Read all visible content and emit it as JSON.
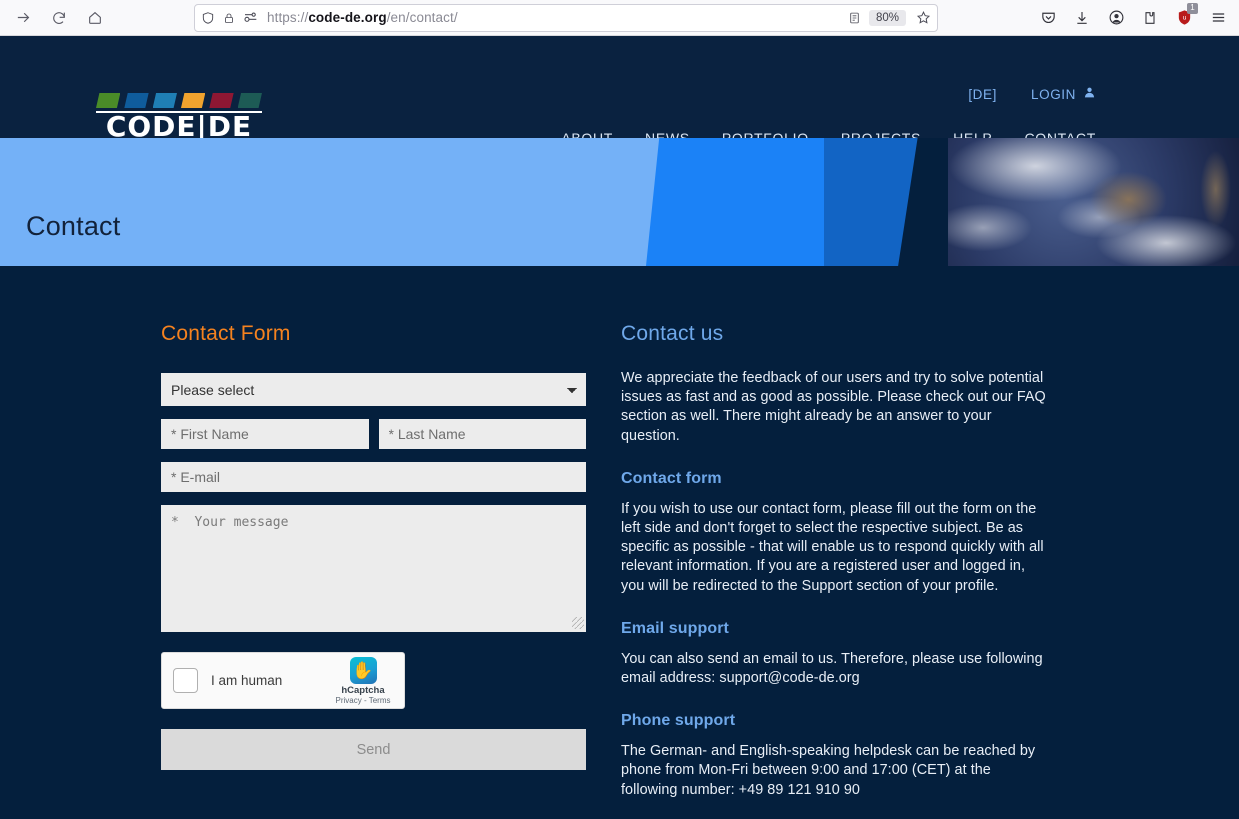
{
  "browser": {
    "url_prefix": "https://",
    "url_host": "code-de.org",
    "url_path": "/en/contact/",
    "zoom_level": "80%",
    "shield_badge": "1",
    "icons": {
      "forward": "forward-arrow-icon",
      "reload": "reload-icon",
      "home": "home-icon",
      "shield": "shield-icon",
      "lock": "lock-icon",
      "permissions": "permissions-icon",
      "reader": "reader-view-icon",
      "bookmark": "star-bookmark-icon",
      "pocket": "pocket-icon",
      "downloads": "downloads-icon",
      "account": "account-icon",
      "extension": "extension-icon",
      "ublock": "ublock-shield-icon",
      "menu": "hamburger-menu-icon"
    }
  },
  "site": {
    "logo_text": "CODE|DE",
    "logo_colors": [
      "#4a8c28",
      "#0f5c9c",
      "#1f7fb5",
      "#f0a32e",
      "#8e1733",
      "#1d5b55"
    ],
    "language_switch": "[DE]",
    "login_label": "LOGIN",
    "nav": [
      "ABOUT",
      "NEWS",
      "PORTFOLIO",
      "PROJECTS",
      "HELP",
      "CONTACT"
    ]
  },
  "hero": {
    "title": "Contact"
  },
  "form": {
    "heading": "Contact Form",
    "subject_selected": "Please select",
    "first_name_placeholder": "* First Name",
    "last_name_placeholder": "* Last Name",
    "email_placeholder": "* E-mail",
    "message_placeholder": "*  Your message",
    "captcha": {
      "checkbox_label": "I am human",
      "brand": "hCaptcha",
      "terms": "Privacy - Terms"
    },
    "send_label": "Send"
  },
  "info": {
    "heading": "Contact us",
    "intro": "We appreciate the feedback of our users and try to solve potential issues as fast and as good as possible. Please check out our FAQ section as well. There might already be an answer to your question.",
    "sections": [
      {
        "title": "Contact form",
        "body": "If you wish to use our contact form, please fill out the form on the left side and don't forget to select the respective subject. Be as specific as possible - that will enable us to respond quickly with all relevant information. If you are a registered user and logged in, you will be redirected to the Support section of your profile."
      },
      {
        "title": "Email support",
        "body": "You can also send an email to us. Therefore, please use following email address: support@code-de.org"
      },
      {
        "title": "Phone support",
        "body": "The German- and English-speaking helpdesk can be reached by phone from Mon-Fri between 9:00 and 17:00 (CET) at the following number: +49 89 121 910 90"
      }
    ]
  },
  "colors": {
    "page_bg": "#041f3d",
    "header_bg": "#0a2240",
    "accent_orange": "#f5821f",
    "accent_blue": "#6fa8ea",
    "hero_light": "#74b1f7"
  }
}
